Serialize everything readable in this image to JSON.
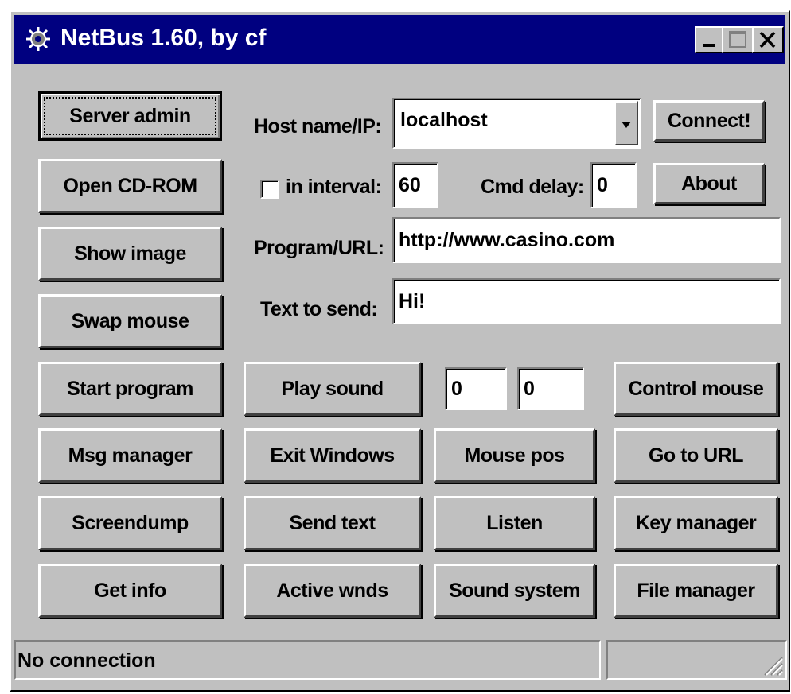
{
  "window": {
    "title": "NetBus 1.60, by cf"
  },
  "icons": {
    "app": "netbus-gear-icon",
    "minimize": "minimize-icon",
    "maximize": "maximize-icon",
    "close": "close-icon",
    "dropdown": "chevron-down-icon",
    "grip": "resize-grip-icon"
  },
  "left_buttons": {
    "server_admin": "Server admin",
    "open_cdrom": "Open CD-ROM",
    "show_image": "Show image",
    "swap_mouse": "Swap mouse"
  },
  "connection": {
    "host_label": "Host name/IP:",
    "host_value": "localhost",
    "connect_label": "Connect!",
    "interval_label": "in interval:",
    "interval_checked": false,
    "interval_value": "60",
    "cmd_delay_label": "Cmd delay:",
    "cmd_delay_value": "0",
    "about_label": "About",
    "program_label": "Program/URL:",
    "program_value": "http://www.casino.com",
    "text_label": "Text to send:",
    "text_value": "Hi!"
  },
  "grid": {
    "start_program": "Start program",
    "play_sound": "Play sound",
    "mouse_x": "0",
    "mouse_y": "0",
    "control_mouse": "Control mouse",
    "msg_manager": "Msg manager",
    "exit_windows": "Exit Windows",
    "mouse_pos": "Mouse pos",
    "go_to_url": "Go to URL",
    "screendump": "Screendump",
    "send_text": "Send text",
    "listen": "Listen",
    "key_manager": "Key manager",
    "get_info": "Get info",
    "active_wnds": "Active wnds",
    "sound_system": "Sound system",
    "file_manager": "File manager"
  },
  "status": {
    "text": "No connection"
  }
}
